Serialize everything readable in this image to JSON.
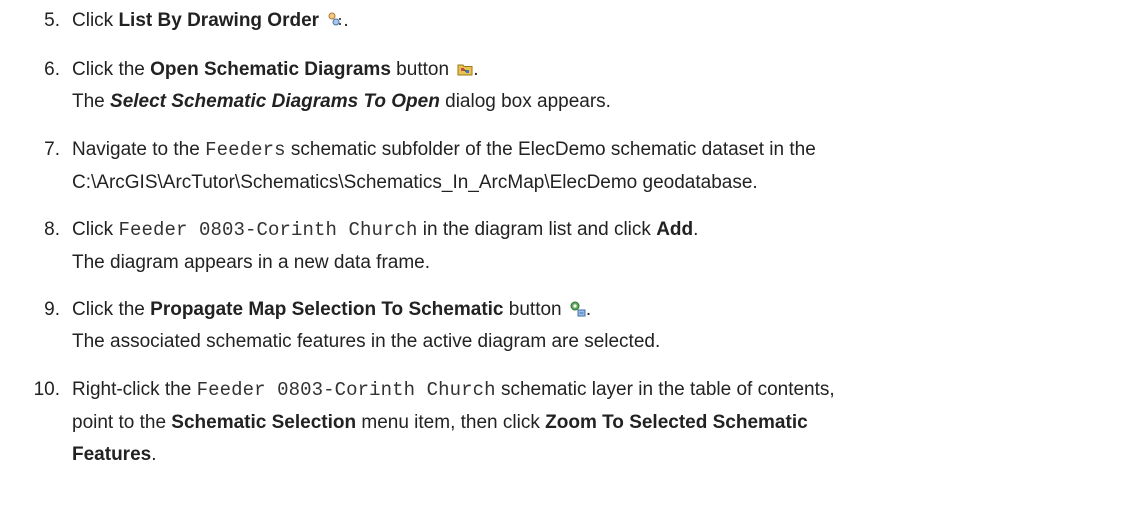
{
  "steps": [
    {
      "number": "5.",
      "parts": [
        [
          "Click ",
          {
            "b": "List By Drawing Order"
          },
          " ",
          {
            "icon": "list-by-drawing-order-icon"
          },
          "."
        ]
      ]
    },
    {
      "number": "6.",
      "parts": [
        [
          "Click the ",
          {
            "b": "Open Schematic Diagrams"
          },
          " button ",
          {
            "icon": "open-schematic-diagrams-icon"
          },
          "."
        ],
        [
          "The ",
          {
            "bi": "Select Schematic Diagrams To Open"
          },
          " dialog box appears."
        ]
      ]
    },
    {
      "number": "7.",
      "parts": [
        [
          "Navigate to the ",
          {
            "mono": "Feeders"
          },
          " schematic subfolder of the ElecDemo schematic dataset in the"
        ],
        [
          "C:\\ArcGIS\\ArcTutor\\Schematics\\Schematics_In_ArcMap\\ElecDemo geodatabase."
        ]
      ]
    },
    {
      "number": "8.",
      "parts": [
        [
          "Click ",
          {
            "mono": "Feeder 0803-Corinth Church"
          },
          " in the diagram list and click ",
          {
            "b": "Add"
          },
          "."
        ],
        [
          "The diagram appears in a new data frame."
        ]
      ]
    },
    {
      "number": "9.",
      "parts": [
        [
          "Click the ",
          {
            "b": "Propagate Map Selection To Schematic"
          },
          " button ",
          {
            "icon": "propagate-map-selection-icon"
          },
          "."
        ],
        [
          "The associated schematic features in the active diagram are selected."
        ]
      ]
    },
    {
      "number": "10.",
      "parts": [
        [
          "Right-click the ",
          {
            "mono": "Feeder 0803-Corinth Church"
          },
          " schematic layer in the table of contents,"
        ],
        [
          "point to the ",
          {
            "b": "Schematic Selection"
          },
          " menu item, then click ",
          {
            "b": "Zoom To Selected Schematic"
          }
        ],
        [
          {
            "b": "Features"
          },
          "."
        ]
      ]
    }
  ]
}
